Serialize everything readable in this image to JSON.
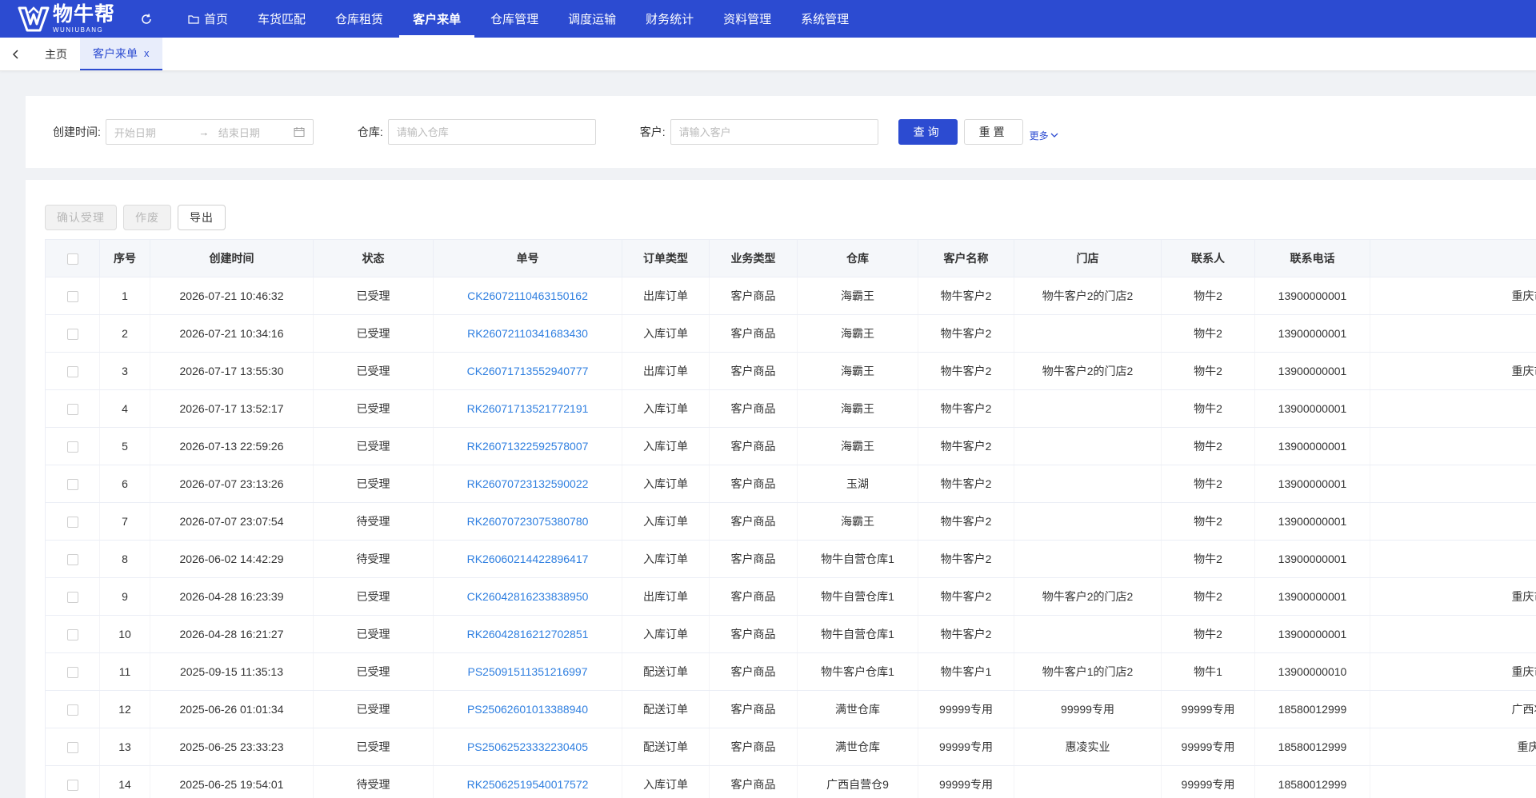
{
  "header": {
    "logo_cn": "物牛帮",
    "logo_en": "WUNIUBANG",
    "nav": [
      "首页",
      "车货匹配",
      "仓库租赁",
      "客户来单",
      "仓库管理",
      "调度运输",
      "财务统计",
      "资料管理",
      "系统管理"
    ],
    "active_nav": 3
  },
  "tabs": {
    "home": "主页",
    "current": "客户来单",
    "close": "x"
  },
  "filter": {
    "created_label": "创建时间:",
    "start_placeholder": "开始日期",
    "end_placeholder": "结束日期",
    "warehouse_label": "仓库:",
    "warehouse_placeholder": "请输入仓库",
    "customer_label": "客户:",
    "customer_placeholder": "请输入客户",
    "query": "查询",
    "reset": "重置",
    "more": "更多"
  },
  "toolbar": {
    "confirm": "确认受理",
    "void": "作废",
    "export": "导出"
  },
  "table": {
    "columns": [
      "序号",
      "创建时间",
      "状态",
      "单号",
      "订单类型",
      "业务类型",
      "仓库",
      "客户名称",
      "门店",
      "联系人",
      "联系电话",
      ""
    ],
    "rows": [
      {
        "no": "1",
        "time": "2026-07-21 10:46:32",
        "status": "已受理",
        "order": "CK26072110463150162",
        "otype": "出库订单",
        "btype": "客户商品",
        "wh": "海霸王",
        "cust": "物牛客户2",
        "store": "物牛客户2的门店2",
        "contact": "物牛2",
        "phone": "13900000001",
        "addr": "重庆市渝北区龙溪街道"
      },
      {
        "no": "2",
        "time": "2026-07-21 10:34:16",
        "status": "已受理",
        "order": "RK26072110341683430",
        "otype": "入库订单",
        "btype": "客户商品",
        "wh": "海霸王",
        "cust": "物牛客户2",
        "store": "",
        "contact": "物牛2",
        "phone": "13900000001",
        "addr": ""
      },
      {
        "no": "3",
        "time": "2026-07-17 13:55:30",
        "status": "已受理",
        "order": "CK26071713552940777",
        "otype": "出库订单",
        "btype": "客户商品",
        "wh": "海霸王",
        "cust": "物牛客户2",
        "store": "物牛客户2的门店2",
        "contact": "物牛2",
        "phone": "13900000001",
        "addr": "重庆市渝北区龙溪街道"
      },
      {
        "no": "4",
        "time": "2026-07-17 13:52:17",
        "status": "已受理",
        "order": "RK26071713521772191",
        "otype": "入库订单",
        "btype": "客户商品",
        "wh": "海霸王",
        "cust": "物牛客户2",
        "store": "",
        "contact": "物牛2",
        "phone": "13900000001",
        "addr": ""
      },
      {
        "no": "5",
        "time": "2026-07-13 22:59:26",
        "status": "已受理",
        "order": "RK26071322592578007",
        "otype": "入库订单",
        "btype": "客户商品",
        "wh": "海霸王",
        "cust": "物牛客户2",
        "store": "",
        "contact": "物牛2",
        "phone": "13900000001",
        "addr": ""
      },
      {
        "no": "6",
        "time": "2026-07-07 23:13:26",
        "status": "已受理",
        "order": "RK26070723132590022",
        "otype": "入库订单",
        "btype": "客户商品",
        "wh": "玉湖",
        "cust": "物牛客户2",
        "store": "",
        "contact": "物牛2",
        "phone": "13900000001",
        "addr": ""
      },
      {
        "no": "7",
        "time": "2026-07-07 23:07:54",
        "status": "待受理",
        "order": "RK26070723075380780",
        "otype": "入库订单",
        "btype": "客户商品",
        "wh": "海霸王",
        "cust": "物牛客户2",
        "store": "",
        "contact": "物牛2",
        "phone": "13900000001",
        "addr": ""
      },
      {
        "no": "8",
        "time": "2026-06-02 14:42:29",
        "status": "待受理",
        "order": "RK26060214422896417",
        "otype": "入库订单",
        "btype": "客户商品",
        "wh": "物牛自营仓库1",
        "cust": "物牛客户2",
        "store": "",
        "contact": "物牛2",
        "phone": "13900000001",
        "addr": ""
      },
      {
        "no": "9",
        "time": "2026-04-28 16:23:39",
        "status": "已受理",
        "order": "CK26042816233838950",
        "otype": "出库订单",
        "btype": "客户商品",
        "wh": "物牛自营仓库1",
        "cust": "物牛客户2",
        "store": "物牛客户2的门店2",
        "contact": "物牛2",
        "phone": "13900000001",
        "addr": "重庆市渝北区龙溪街道"
      },
      {
        "no": "10",
        "time": "2026-04-28 16:21:27",
        "status": "已受理",
        "order": "RK26042816212702851",
        "otype": "入库订单",
        "btype": "客户商品",
        "wh": "物牛自营仓库1",
        "cust": "物牛客户2",
        "store": "",
        "contact": "物牛2",
        "phone": "13900000001",
        "addr": ""
      },
      {
        "no": "11",
        "time": "2025-09-15 11:35:13",
        "status": "已受理",
        "order": "PS25091511351216997",
        "otype": "配送订单",
        "btype": "客户商品",
        "wh": "物牛客户仓库1",
        "cust": "物牛客户1",
        "store": "物牛客户1的门店2",
        "contact": "物牛1",
        "phone": "13900000010",
        "addr": "重庆市沙坪坝区陈家桥"
      },
      {
        "no": "12",
        "time": "2025-06-26 01:01:34",
        "status": "已受理",
        "order": "PS25062601013388940",
        "otype": "配送订单",
        "btype": "客户商品",
        "wh": "满世仓库",
        "cust": "99999专用",
        "store": "99999专用",
        "contact": "99999专用",
        "phone": "18580012999",
        "addr": "广西壮族自治区柳州市"
      },
      {
        "no": "13",
        "time": "2025-06-25 23:33:23",
        "status": "已受理",
        "order": "PS25062523332230405",
        "otype": "配送订单",
        "btype": "客户商品",
        "wh": "满世仓库",
        "cust": "99999专用",
        "store": "惠凌实业",
        "contact": "99999专用",
        "phone": "18580012999",
        "addr": "重庆市九龙坡区惠济"
      },
      {
        "no": "14",
        "time": "2025-06-25 19:54:01",
        "status": "待受理",
        "order": "RK25062519540017572",
        "otype": "入库订单",
        "btype": "客户商品",
        "wh": "广西自营仓9",
        "cust": "99999专用",
        "store": "",
        "contact": "99999专用",
        "phone": "18580012999",
        "addr": ""
      }
    ]
  },
  "colors": {
    "primary": "#2c4bd1",
    "link": "#2f7fe0",
    "page_bg": "#f0f2f5"
  }
}
